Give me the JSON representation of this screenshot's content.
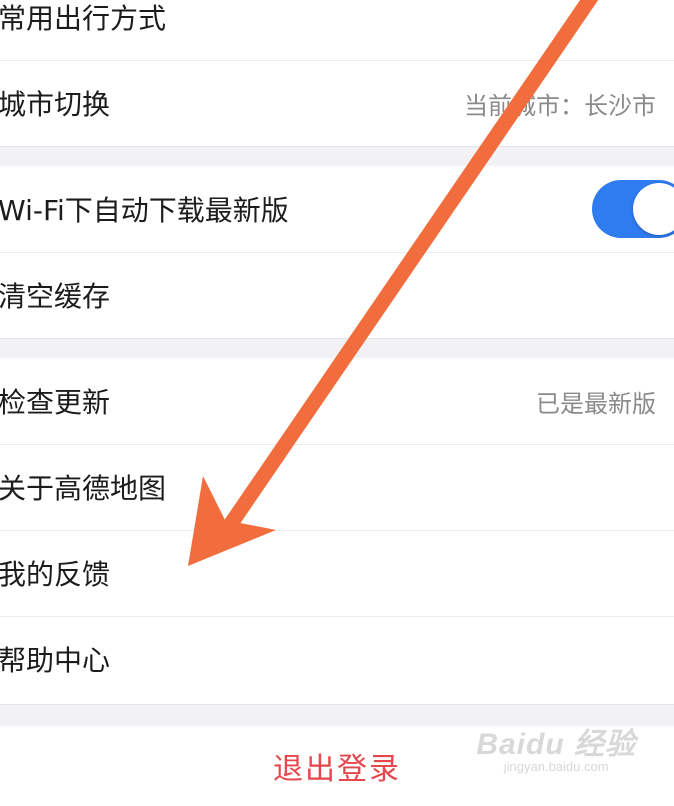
{
  "section1": {
    "items": [
      {
        "label": "常用出行方式",
        "value": ""
      },
      {
        "label": "城市切换",
        "value": "当前城市：长沙市"
      }
    ]
  },
  "section2": {
    "items": [
      {
        "label": "Wi-Fi下自动下载最新版",
        "toggle_on": true
      },
      {
        "label": "清空缓存"
      }
    ]
  },
  "section3": {
    "items": [
      {
        "label": "检查更新",
        "value": "已是最新版"
      },
      {
        "label": "关于高德地图"
      },
      {
        "label": "我的反馈"
      },
      {
        "label": "帮助中心"
      }
    ]
  },
  "logout_label": "退出登录",
  "watermark": {
    "brand": "Baidu 经验",
    "url": "jingyan.baidu.com"
  },
  "colors": {
    "accent": "#2f7bf0",
    "logout": "#e5474d",
    "annotation_arrow": "#f26d3d"
  }
}
